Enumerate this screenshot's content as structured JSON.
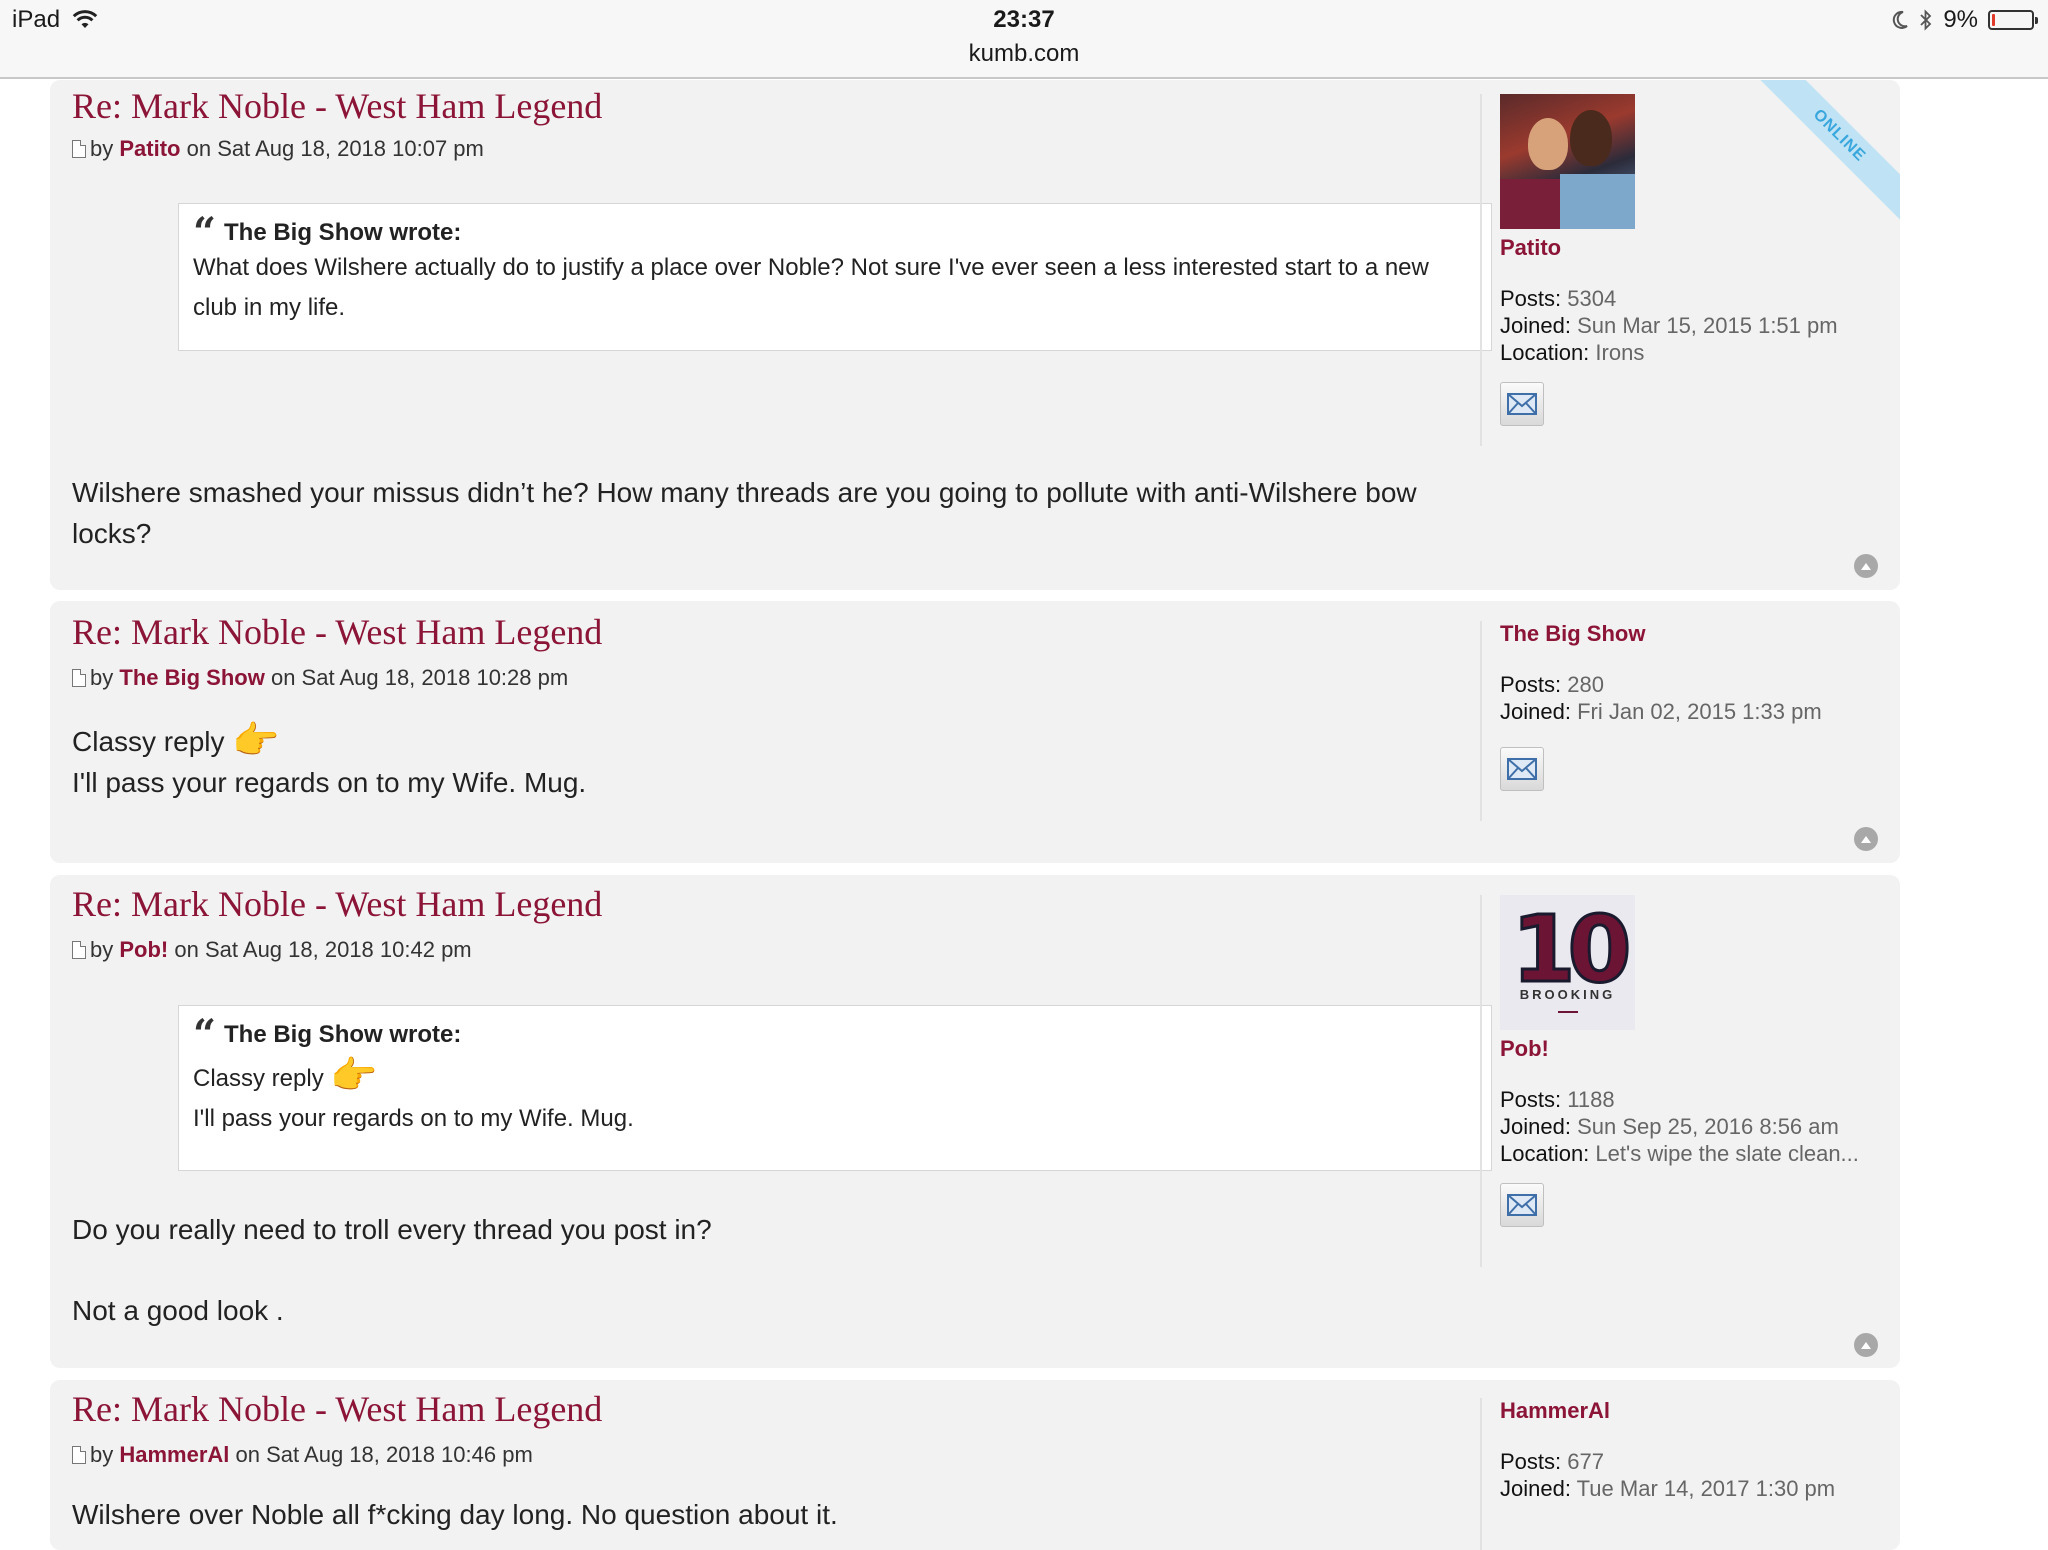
{
  "status_bar": {
    "device": "iPad",
    "time": "23:37",
    "url": "kumb.com",
    "battery_percent": "9%",
    "battery_level": 0.09
  },
  "posts": [
    {
      "title": "Re: Mark Noble - West Ham Legend",
      "by": "by",
      "author": "Patito",
      "date": "on Sat Aug 18, 2018 10:07 pm",
      "quote": {
        "author": "The Big Show wrote:",
        "text": "What does Wilshere actually do to justify a place over Noble? Not sure I've ever seen a less interested start to a new club in my life."
      },
      "text": "Wilshere smashed your missus didn’t he? How many threads are you going to pollute with anti-Wilshere bow locks?",
      "profile": {
        "username": "Patito",
        "online_label": "ONLINE",
        "posts_label": "Posts:",
        "posts": "5304",
        "joined_label": "Joined:",
        "joined": "Sun Mar 15, 2015 1:51 pm",
        "location_label": "Location:",
        "location": "Irons"
      }
    },
    {
      "title": "Re: Mark Noble - West Ham Legend",
      "by": "by",
      "author": "The Big Show",
      "date": "on Sat Aug 18, 2018 10:28 pm",
      "text_line1": "Classy reply",
      "text_line2": "I'll pass your regards on to my Wife. Mug.",
      "profile": {
        "username": "The Big Show",
        "posts_label": "Posts:",
        "posts": "280",
        "joined_label": "Joined:",
        "joined": "Fri Jan 02, 2015 1:33 pm"
      }
    },
    {
      "title": "Re: Mark Noble - West Ham Legend",
      "by": "by",
      "author": "Pob!",
      "date": "on Sat Aug 18, 2018 10:42 pm",
      "quote": {
        "author": "The Big Show wrote:",
        "line1": "Classy reply",
        "line2": "I'll pass your regards on to my Wife. Mug."
      },
      "text_line1": "Do you really need to troll every thread you post in?",
      "text_line2": "Not a good look .",
      "profile": {
        "username": "Pob!",
        "avatar_text": "10",
        "avatar_sub": "BROOKING",
        "posts_label": "Posts:",
        "posts": "1188",
        "joined_label": "Joined:",
        "joined": "Sun Sep 25, 2016 8:56 am",
        "location_label": "Location:",
        "location": "Let's wipe the slate clean..."
      }
    },
    {
      "title": "Re: Mark Noble - West Ham Legend",
      "by": "by",
      "author": "HammerAl",
      "date": "on Sat Aug 18, 2018 10:46 pm",
      "text": "Wilshere over Noble all f*cking day long. No question about it.",
      "profile": {
        "username": "HammerAl",
        "posts_label": "Posts:",
        "posts": "677",
        "joined_label": "Joined:",
        "joined": "Tue Mar 14, 2017 1:30 pm"
      }
    }
  ],
  "icons": {
    "post_icon": "document-icon",
    "quote_icon": "quote-icon",
    "pm_icon": "envelope-icon",
    "top_icon": "arrow-up-icon",
    "thumb_emoji": "👉"
  }
}
